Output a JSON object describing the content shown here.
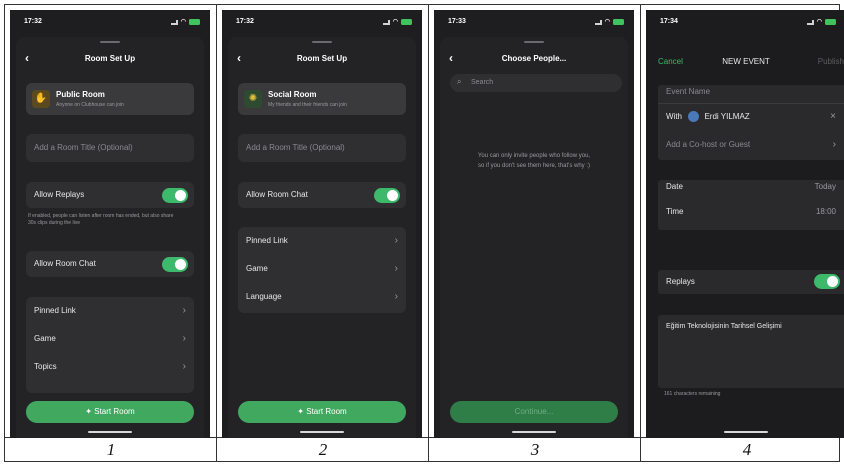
{
  "captions": [
    "1",
    "2",
    "3",
    "4"
  ],
  "screen1": {
    "status_time": "17:32",
    "title": "Room Set Up",
    "room_name": "Public Room",
    "room_desc": "Anyone on Clubhouse can join",
    "title_placeholder": "Add a Room Title (Optional)",
    "replays_label": "Allow Replays",
    "replays_note": "If enabled, people can listen after room has ended, but also share 30s clips during the live",
    "chat_label": "Allow Room Chat",
    "menu": [
      "Pinned Link",
      "Game",
      "Topics"
    ],
    "start_button": "Start Room"
  },
  "screen2": {
    "status_time": "17:32",
    "title": "Room Set Up",
    "room_name": "Social Room",
    "room_desc": "My friends and their friends can join",
    "title_placeholder": "Add a Room Title (Optional)",
    "chat_label": "Allow Room Chat",
    "menu": [
      "Pinned Link",
      "Game",
      "Language"
    ],
    "start_button": "Start Room"
  },
  "screen3": {
    "status_time": "17:33",
    "title": "Choose People...",
    "search_placeholder": "Search",
    "info_line1": "You can only invite people who follow you,",
    "info_line2": "so if you don't see them here, that's why :)",
    "continue_button": "Continue..."
  },
  "screen4": {
    "status_time": "17:34",
    "cancel": "Cancel",
    "title": "NEW EVENT",
    "publish": "Publish",
    "event_name_placeholder": "Event Name",
    "with_label": "With",
    "host_name": "Erdi YILMAZ",
    "cohost_label": "Add a Co-host or Guest",
    "date_label": "Date",
    "date_value": "Today",
    "time_label": "Time",
    "time_value": "18:00",
    "replays_label": "Replays",
    "description": "Eğitim Teknolojisinin Tarihsel Gelişimi",
    "chars_remaining": "161 characters remaining"
  },
  "colors": {
    "accent_green": "#41a95f",
    "toggle_green": "#3cb96a",
    "background": "#1e1e20",
    "card": "#2f2f32"
  }
}
